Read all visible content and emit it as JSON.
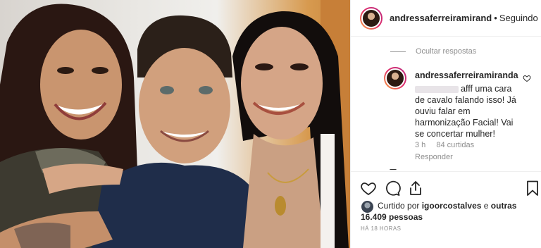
{
  "photo": {
    "alt_subject": "selfie-three-people",
    "watermark_present": false
  },
  "post": {
    "author": "andressaferreiramirand",
    "separator": "•",
    "follow_status": "Seguindo"
  },
  "comments": {
    "hide_replies_label": "Ocultar respostas",
    "items": [
      {
        "username": "andressaferreiramiranda",
        "text": "afff uma cara de cavalo falando isso! Já ouviu falar em harmonização Facial! Vai se concertar mulher!",
        "age": "3 h",
        "likes": "84 curtidas",
        "reply_label": "Responder"
      }
    ]
  },
  "actions": {
    "like_icon": "heart-icon",
    "comment_icon": "comment-icon",
    "share_icon": "share-icon",
    "save_icon": "bookmark-icon"
  },
  "likes": {
    "prefix": "Curtido por",
    "user": "igoorcostalves",
    "connector": "e",
    "others": "outras 16.409 pessoas"
  },
  "timestamp": "HÁ 18 HORAS",
  "colors": {
    "border": "#efefef",
    "muted_text": "#8e8e8e",
    "primary_text": "#262626",
    "story_ring_start": "#f9a43c",
    "story_ring_end": "#b6287f"
  }
}
